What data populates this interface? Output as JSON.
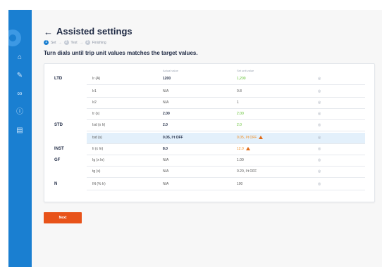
{
  "header": {
    "back_arrow": "←",
    "title": "Assisted settings"
  },
  "steps": [
    {
      "number": "1",
      "label": "Set"
    },
    {
      "number": "2",
      "label": "Test"
    },
    {
      "number": "3",
      "label": "Finishing"
    }
  ],
  "step_arrow": "→",
  "instruction": "Turn dials until trip unit values matches the target values.",
  "table": {
    "columns": [
      "",
      "",
      "Actual value",
      "Set unit value",
      ""
    ],
    "view_icon": "eye-icon",
    "rows": [
      {
        "group": "LTD",
        "param": "Ir (A)",
        "current": "1200",
        "target": "1,200",
        "target_color": "green"
      },
      {
        "group": "",
        "param": "Ir1",
        "current": "N/A",
        "target": "0.8"
      },
      {
        "group": "",
        "param": "Ir2",
        "current": "N/A",
        "target": "1"
      },
      {
        "group": "",
        "param": "tr (s)",
        "current": "2.00",
        "target": "2.00",
        "target_color": "green"
      },
      {
        "group": "STD",
        "param": "Isd (x Ir)",
        "current": "2.0",
        "target": "2.0",
        "target_color": "green"
      },
      {
        "group": "",
        "param": "tsd (s)",
        "current": "0.05, I²t OFF",
        "target": "0.05, I²t OFF",
        "target_color": "orange",
        "warning": true,
        "highlight": true
      },
      {
        "group": "INST",
        "param": "Ii (x In)",
        "current": "8.0",
        "target": "12.0",
        "target_color": "orange",
        "warning": true
      },
      {
        "group": "GF",
        "param": "Ig (x In)",
        "current": "N/A",
        "target": "1.00"
      },
      {
        "group": "",
        "param": "tg (s)",
        "current": "N/A",
        "target": "0.20, I²t OFF"
      },
      {
        "group": "N",
        "param": "IN (% Ir)",
        "current": "N/A",
        "target": "100"
      }
    ]
  },
  "next_button": "Next",
  "colors": {
    "accent": "#1a7fd1",
    "next": "#e8531a",
    "green": "#5cbf2a",
    "orange": "#f08a1c"
  }
}
